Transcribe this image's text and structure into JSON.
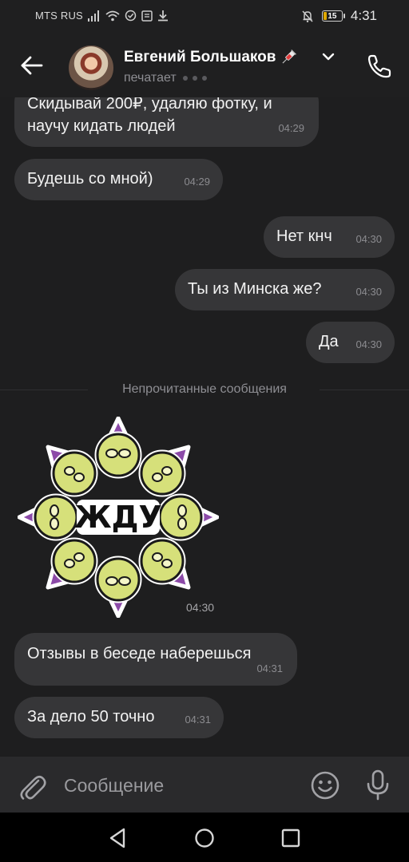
{
  "status_bar": {
    "carrier": "MTS RUS",
    "battery_level": "15",
    "time": "4:31",
    "icons": [
      "signal-icon",
      "wifi-icon",
      "sync-check-icon",
      "notes-icon",
      "download-icon",
      "mute-notifications-icon",
      "battery-icon"
    ]
  },
  "header": {
    "contact_name": "Евгений Большаков",
    "name_emoji": "syringe-icon",
    "status": "печатает",
    "back_icon": "arrow-left-icon",
    "call_icon": "phone-icon"
  },
  "messages": [
    {
      "side": "in",
      "text": "Скидывай 200₽, удаляю фотку, и\nнаучу кидать людей",
      "time": "04:29"
    },
    {
      "side": "in",
      "text": "Будешь со мной)",
      "time": "04:29"
    },
    {
      "side": "out",
      "text": "Нет кнч",
      "time": "04:30"
    },
    {
      "side": "out",
      "text": "Ты из Минска же?",
      "time": "04:30"
    },
    {
      "side": "out",
      "text": "Да",
      "time": "04:30"
    }
  ],
  "unread_divider": "Непрочитанные сообщения",
  "sticker": {
    "text": "ЖДУ",
    "time": "04:30"
  },
  "messages_after": [
    {
      "side": "in",
      "text": "Отзывы в беседе наберешься",
      "time": "04:31"
    },
    {
      "side": "in",
      "text": "За дело 50 точно",
      "time": "04:31"
    }
  ],
  "composer": {
    "placeholder": "Сообщение"
  },
  "colors": {
    "background": "#1e1e1f",
    "bubble": "#363638",
    "composer": "#2a2a2c",
    "sticker_face": "#d6e07a",
    "sticker_spike": "#8c4aa8"
  }
}
